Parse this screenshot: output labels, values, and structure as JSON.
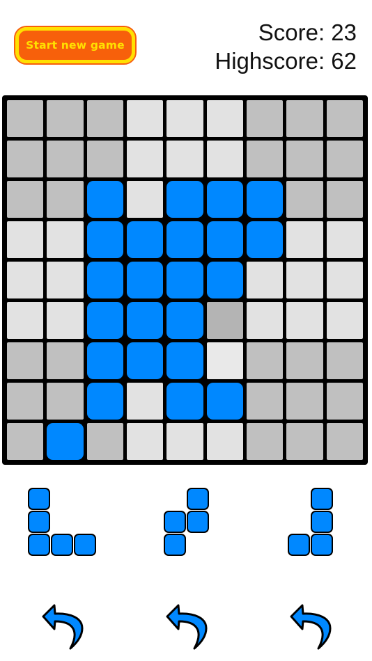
{
  "header": {
    "start_button_label": "Start new game",
    "score_label": "Score: 23",
    "highscore_label": "Highscore: 62",
    "score_value": 23,
    "highscore_value": 62
  },
  "colors": {
    "blue": "#0088ff",
    "cell_dark": "#c0c0c0",
    "cell_light": "#e2e2e2",
    "grid_line": "#000000",
    "button_fill": "#f7600b",
    "button_border": "#ffe000",
    "button_text": "#ffe000",
    "text": "#111111"
  },
  "board": {
    "rows": 9,
    "cols": 9,
    "block_size": 3,
    "legend": {
      "0": "empty",
      "1": "filled-blue",
      "2": "hint-dark",
      "3": "hint-light"
    },
    "grid": [
      [
        0,
        0,
        0,
        0,
        0,
        0,
        0,
        0,
        0
      ],
      [
        0,
        0,
        0,
        0,
        0,
        0,
        0,
        0,
        0
      ],
      [
        0,
        0,
        1,
        0,
        1,
        1,
        1,
        0,
        0
      ],
      [
        0,
        0,
        1,
        1,
        1,
        1,
        1,
        0,
        0
      ],
      [
        0,
        0,
        1,
        1,
        1,
        1,
        0,
        0,
        0
      ],
      [
        0,
        0,
        1,
        1,
        1,
        2,
        0,
        0,
        0
      ],
      [
        0,
        0,
        1,
        1,
        1,
        3,
        0,
        0,
        0
      ],
      [
        0,
        0,
        1,
        0,
        1,
        1,
        0,
        0,
        0
      ],
      [
        0,
        1,
        0,
        0,
        0,
        0,
        0,
        0,
        0
      ]
    ]
  },
  "pieces": [
    {
      "name": "piece-j-corner",
      "cols": 3,
      "rows": 3,
      "cells": [
        [
          1,
          0,
          0
        ],
        [
          1,
          0,
          0
        ],
        [
          1,
          1,
          1
        ]
      ]
    },
    {
      "name": "piece-s-zigzag",
      "cols": 2,
      "rows": 3,
      "cells": [
        [
          0,
          1
        ],
        [
          1,
          1
        ],
        [
          1,
          0
        ]
      ]
    },
    {
      "name": "piece-j-small",
      "cols": 2,
      "rows": 3,
      "cells": [
        [
          0,
          1
        ],
        [
          0,
          1
        ],
        [
          1,
          1
        ]
      ]
    }
  ],
  "undo_buttons": [
    {
      "name": "undo-icon-0",
      "label": "undo-arrow-icon"
    },
    {
      "name": "undo-icon-1",
      "label": "undo-arrow-icon"
    },
    {
      "name": "undo-icon-2",
      "label": "undo-arrow-icon"
    }
  ]
}
